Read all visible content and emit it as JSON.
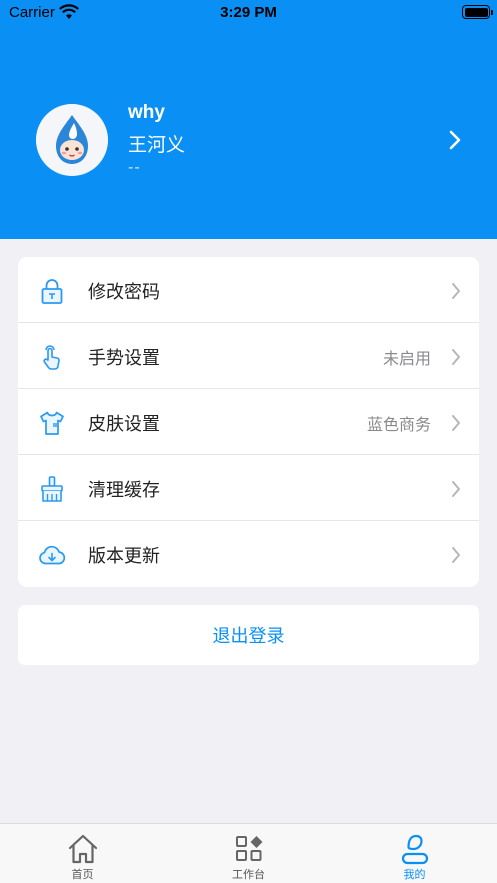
{
  "status_bar": {
    "carrier": "Carrier",
    "time": "3:29 PM"
  },
  "profile": {
    "username": "why",
    "real_name": "王河义",
    "department": "--"
  },
  "menu": [
    {
      "icon": "lock-icon",
      "label": "修改密码",
      "value": ""
    },
    {
      "icon": "gesture-tap-icon",
      "label": "手势设置",
      "value": "未启用"
    },
    {
      "icon": "tshirt-icon",
      "label": "皮肤设置",
      "value": "蓝色商务"
    },
    {
      "icon": "broom-icon",
      "label": "清理缓存",
      "value": ""
    },
    {
      "icon": "cloud-download-icon",
      "label": "版本更新",
      "value": ""
    }
  ],
  "logout_label": "退出登录",
  "tabbar": [
    {
      "icon": "home-icon",
      "label": "首页",
      "active": false
    },
    {
      "icon": "workbench-icon",
      "label": "工作台",
      "active": false
    },
    {
      "icon": "user-icon",
      "label": "我的",
      "active": true
    }
  ],
  "colors": {
    "accent": "#0a8ff5",
    "background": "#f0f0f5",
    "card": "#ffffff"
  }
}
